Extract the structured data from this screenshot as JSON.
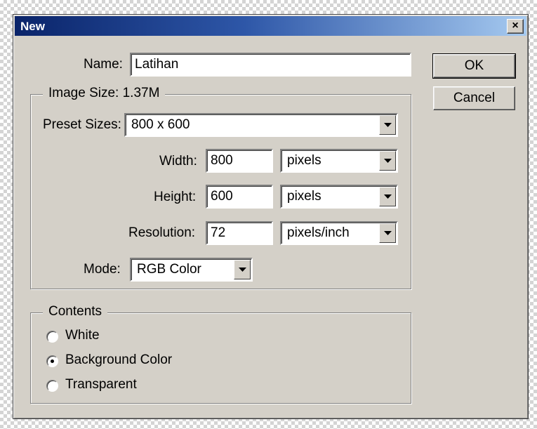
{
  "dialog": {
    "title": "New",
    "close_label": "×"
  },
  "name": {
    "label": "Name:",
    "value": "Latihan"
  },
  "buttons": {
    "ok": "OK",
    "cancel": "Cancel"
  },
  "image_size": {
    "legend": "Image Size: 1.37M",
    "preset_label": "Preset Sizes:",
    "preset_value": "800 x 600",
    "width_label": "Width:",
    "width_value": "800",
    "width_unit": "pixels",
    "height_label": "Height:",
    "height_value": "600",
    "height_unit": "pixels",
    "resolution_label": "Resolution:",
    "resolution_value": "72",
    "resolution_unit": "pixels/inch",
    "mode_label": "Mode:",
    "mode_value": "RGB Color"
  },
  "contents": {
    "legend": "Contents",
    "options": [
      {
        "label": "White",
        "selected": false
      },
      {
        "label": "Background Color",
        "selected": true
      },
      {
        "label": "Transparent",
        "selected": false
      }
    ]
  },
  "colors": {
    "dialog_bg": "#d4d0c8",
    "title_gradient_start": "#0a246a",
    "title_gradient_end": "#a6caf0"
  }
}
